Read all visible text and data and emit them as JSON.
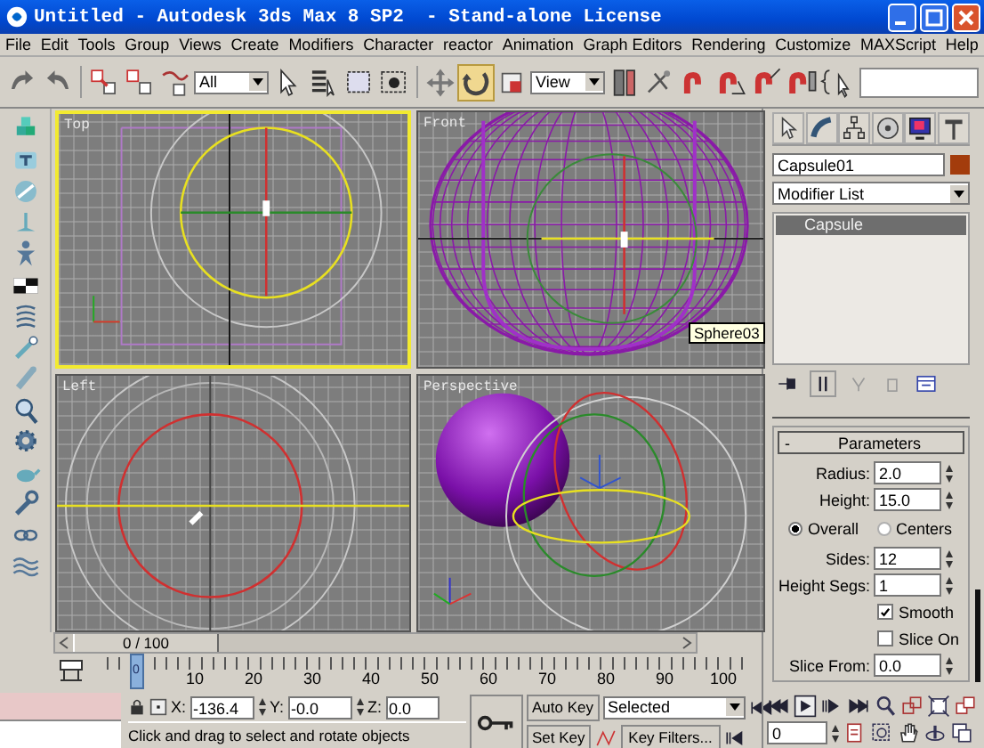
{
  "window": {
    "title": "Untitled - Autodesk 3ds Max 8 SP2  - Stand-alone License"
  },
  "menu": [
    "File",
    "Edit",
    "Tools",
    "Group",
    "Views",
    "Create",
    "Modifiers",
    "Character",
    "reactor",
    "Animation",
    "Graph Editors",
    "Rendering",
    "Customize",
    "MAXScript",
    "Help"
  ],
  "toolbar": {
    "selection_filter": "All",
    "reference_coord": "View",
    "tools": [
      {
        "kind": "move",
        "selected": false
      },
      {
        "kind": "rotate",
        "selected": true
      },
      {
        "kind": "scale",
        "selected": false
      }
    ]
  },
  "viewports": [
    {
      "label": "Top",
      "kind": "top",
      "selected": true
    },
    {
      "label": "Front",
      "kind": "front",
      "selected": false
    },
    {
      "label": "Left",
      "kind": "left",
      "selected": false
    },
    {
      "label": "Perspective",
      "kind": "perspective",
      "selected": false
    }
  ],
  "tooltip": "Sphere03",
  "time_slider": {
    "label": "0 / 100",
    "level": 0
  },
  "track_bar": {
    "current": "0",
    "labels": [
      "10",
      "20",
      "30",
      "40",
      "50",
      "60",
      "70",
      "80",
      "90",
      "100"
    ]
  },
  "coordinates": [
    {
      "label": "X:",
      "value": "-136.4"
    },
    {
      "label": "Y:",
      "value": "-0.0"
    },
    {
      "label": "Z:",
      "value": "0.0"
    }
  ],
  "prompt": "Click and drag to select and rotate objects",
  "animation": {
    "auto_key": "Auto Key",
    "key_mode": "Selected",
    "set_key": "Set Key",
    "key_filters": "Key Filters...",
    "frame": "0"
  },
  "command_panel": {
    "object_name": "Capsule01",
    "modifier_list": "Modifier List",
    "stack": [
      {
        "label": "Capsule",
        "selected": true
      }
    ],
    "rollout": {
      "sign": "-",
      "title": "Parameters"
    },
    "params": [
      {
        "kind": "spinner",
        "label": "Radius:",
        "value": "2.0"
      },
      {
        "kind": "spinner",
        "label": "Height:",
        "value": "15.0"
      },
      {
        "kind": "radios",
        "options": [
          {
            "label": "Overall",
            "selected": true
          },
          {
            "label": "Centers",
            "selected": false
          }
        ]
      },
      {
        "kind": "spinner",
        "label": "Sides:",
        "value": "12"
      },
      {
        "kind": "spinner",
        "label": "Height Segs:",
        "value": "1"
      },
      {
        "kind": "checkbox",
        "label": "Smooth",
        "checked": true
      },
      {
        "kind": "checkbox",
        "label": "Slice On",
        "checked": false
      },
      {
        "kind": "spinner",
        "label": "Slice From:",
        "value": "0.0"
      }
    ]
  }
}
